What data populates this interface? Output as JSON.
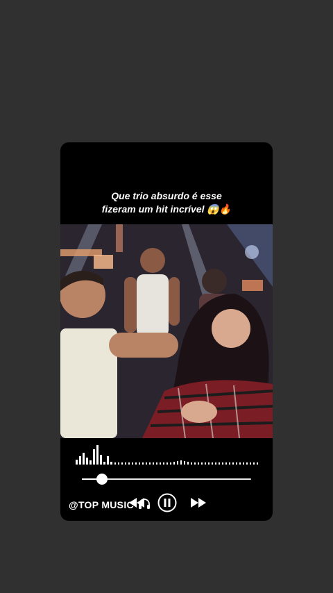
{
  "caption": {
    "line1": "Que trio absurdo é esse",
    "line2": "fizeram um hit incrível 😱🔥"
  },
  "player": {
    "progress_fraction": 0.12,
    "controls": {
      "previous_icon": "rewind-icon",
      "play_pause_icon": "pause-icon",
      "next_icon": "fast-forward-icon"
    }
  },
  "watermark": {
    "label": "@TOP MUSIC",
    "icon": "headphones-icon"
  },
  "colors": {
    "page_background": "#303030",
    "card_background": "#000000",
    "accent": "#ffffff"
  }
}
